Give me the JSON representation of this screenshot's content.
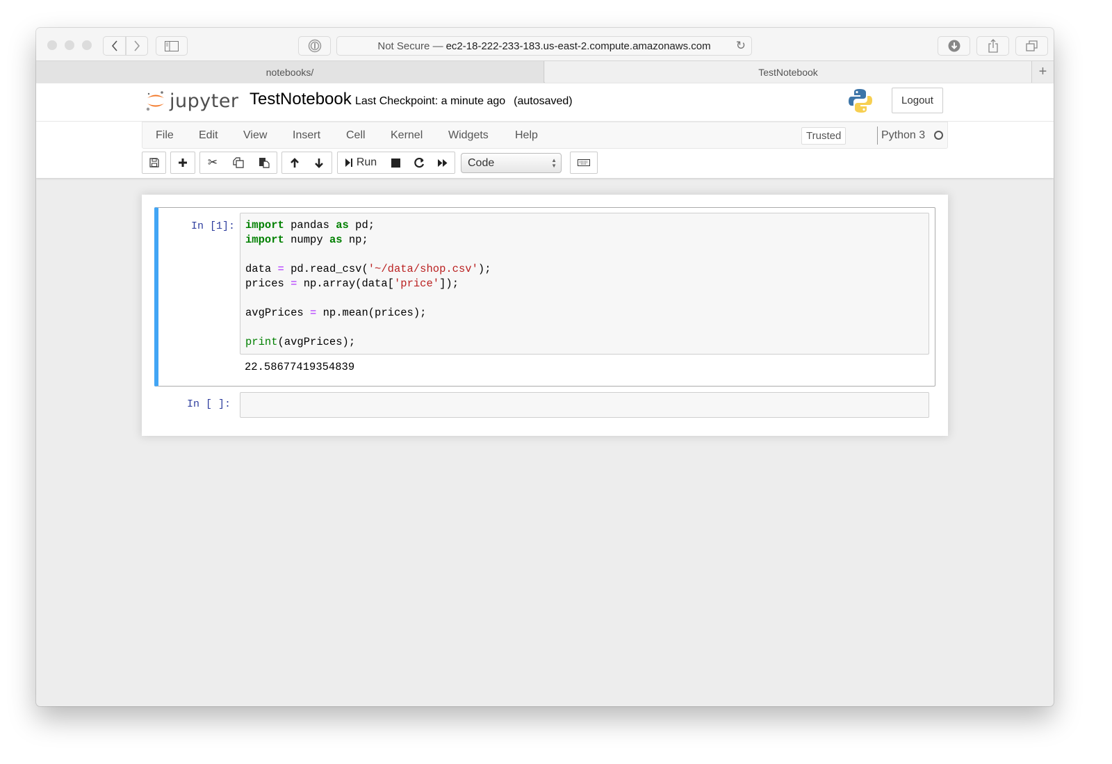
{
  "browser": {
    "address": {
      "security_label": "Not Secure —",
      "host": "ec2-18-222-233-183.us-east-2.compute.amazonaws.com"
    },
    "tabs": [
      {
        "label": "notebooks/",
        "active": false
      },
      {
        "label": "TestNotebook",
        "active": true
      }
    ],
    "new_tab_label": "+"
  },
  "jupyter": {
    "logo_text": "jupyter",
    "notebook_title": "TestNotebook",
    "checkpoint": "Last Checkpoint: a minute ago",
    "autosave_status": "(autosaved)",
    "logout_label": "Logout",
    "menu": [
      "File",
      "Edit",
      "View",
      "Insert",
      "Cell",
      "Kernel",
      "Widgets",
      "Help"
    ],
    "trusted_label": "Trusted",
    "kernel_name": "Python 3",
    "kernel_status": "idle",
    "toolbar": {
      "run_label": "Run",
      "cell_type": "Code"
    }
  },
  "cells": [
    {
      "prompt": "In [1]:",
      "code_lines": [
        "import pandas as pd;",
        "import numpy as np;",
        "",
        "data = pd.read_csv('~/data/shop.csv');",
        "prices = np.array(data['price']);",
        "",
        "avgPrices = np.mean(prices);",
        "",
        "print(avgPrices);"
      ],
      "output": "22.58677419354839"
    },
    {
      "prompt": "In [ ]:",
      "code_lines": [],
      "output": ""
    }
  ],
  "colors": {
    "selected_cell_accent": "#42a5f5",
    "prompt_color": "#303f9f",
    "keyword_color": "#008000",
    "operator_color": "#aa22ff",
    "string_color": "#ba2121",
    "jupyter_orange": "#f37726"
  }
}
